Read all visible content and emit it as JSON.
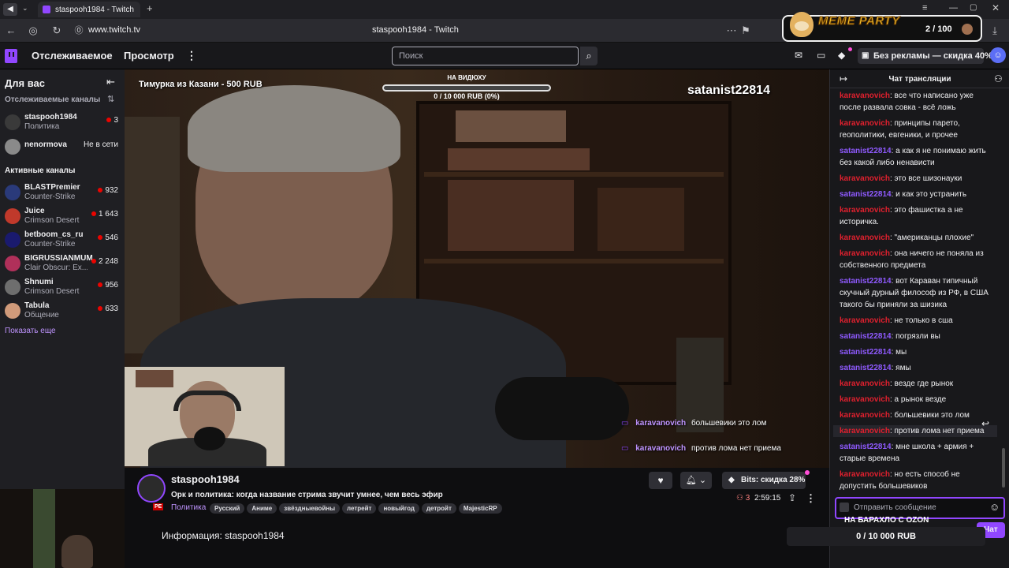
{
  "browser": {
    "tab_title": "staspooh1984 - Twitch",
    "url": "www.twitch.tv",
    "page_title": "staspooh1984 - Twitch"
  },
  "meme_party": {
    "title": "MEME PARTY",
    "counter": "2 / 100"
  },
  "nav": {
    "following": "Отслеживаемое",
    "browse": "Просмотр",
    "search_placeholder": "Поиск",
    "promo": "Без рекламы — скидка 40%"
  },
  "sidebar": {
    "for_you": "Для вас",
    "followed_heading": "Отслеживаемые каналы",
    "followed": [
      {
        "name": "staspooh1984",
        "game": "Политика",
        "viewers": "3",
        "live": true
      },
      {
        "name": "nenormova",
        "game": "",
        "viewers": "Не в сети",
        "live": false
      }
    ],
    "active_heading": "Активные каналы",
    "active": [
      {
        "name": "BLASTPremier",
        "game": "Counter-Strike",
        "viewers": "932"
      },
      {
        "name": "Juice",
        "game": "Crimson Desert",
        "viewers": "1 643"
      },
      {
        "name": "betboom_cs_ru",
        "game": "Counter-Strike",
        "viewers": "546"
      },
      {
        "name": "BIGRUSSIANMUM",
        "game": "Clair Obscur: Ex...",
        "viewers": "2 248"
      },
      {
        "name": "Shnumi",
        "game": "Crimson Desert",
        "viewers": "956"
      },
      {
        "name": "Tabula",
        "game": "Общение",
        "viewers": "633"
      }
    ],
    "show_more": "Показать еще"
  },
  "overlay": {
    "donation": "Тимурка из Казани - 500 RUB",
    "goal_label": "НА ВИДЮХУ",
    "goal_value": "0 / 10 000 RUB (0%)",
    "goal_progress": 0,
    "corner_name": "satanist22814",
    "video_chat": [
      {
        "user": "karavanovich",
        "text": "большевики это лом"
      },
      {
        "user": "karavanovich",
        "text": "против лома нет приема"
      }
    ]
  },
  "stream": {
    "channel": "staspooh1984",
    "title": "Орк и политика: когда название стрима звучит умнее, чем весь эфир",
    "category": "Политика",
    "tags": [
      "Русский",
      "Аниме",
      "звёздныевойны",
      "летрейт",
      "новыйгод",
      "детройт",
      "MajesticRP"
    ],
    "viewers": "3",
    "uptime": "2:59:15",
    "bits_label": "Bits: скидка 28%",
    "about": "Информация: staspooh1984"
  },
  "chat": {
    "header": "Чат трансляции",
    "messages": [
      {
        "user": "karavanovich",
        "color": "red",
        "text": "все что написано уже после развала совка - всё ложь",
        "lines": 2
      },
      {
        "user": "karavanovich",
        "color": "red",
        "text": "принципы парето, геополитики, евгеники, и прочее",
        "lines": 2
      },
      {
        "user": "satanist22814",
        "color": "purple",
        "text": "а как я не понимаю жить без какой либо ненависти",
        "lines": 2
      },
      {
        "user": "karavanovich",
        "color": "red",
        "text": "это все шизонауки",
        "lines": 1
      },
      {
        "user": "satanist22814",
        "color": "purple",
        "text": "и как это устранить",
        "lines": 1
      },
      {
        "user": "karavanovich",
        "color": "red",
        "text": "это фашистка а не историчка.",
        "lines": 2
      },
      {
        "user": "karavanovich",
        "color": "red",
        "text": "\"американцы плохие\"",
        "lines": 1
      },
      {
        "user": "karavanovich",
        "color": "red",
        "text": "она ничего не поняла из собственного предмета",
        "lines": 2
      },
      {
        "user": "satanist22814",
        "color": "purple",
        "text": "вот Караван типичный скучный дурный философ из РФ, в США такого бы приняли за шизика",
        "lines": 3
      },
      {
        "user": "karavanovich",
        "color": "red",
        "text": "не только в сша",
        "lines": 1
      },
      {
        "user": "satanist22814",
        "color": "purple",
        "text": "погрязли вы",
        "lines": 1
      },
      {
        "user": "satanist22814",
        "color": "purple",
        "text": "мы",
        "lines": 1
      },
      {
        "user": "satanist22814",
        "color": "purple",
        "text": "ямы",
        "lines": 1
      },
      {
        "user": "karavanovich",
        "color": "red",
        "text": "везде где рынок",
        "lines": 1
      },
      {
        "user": "karavanovich",
        "color": "red",
        "text": "а рынок везде",
        "lines": 1
      },
      {
        "user": "karavanovich",
        "color": "red",
        "text": "большевики это лом",
        "lines": 1
      },
      {
        "user": "karavanovich",
        "color": "red",
        "text": "против лома нет приема",
        "lines": 1
      },
      {
        "user": "satanist22814",
        "color": "purple",
        "text": "мне школа + армия + старые времена",
        "lines": 2
      },
      {
        "user": "karavanovich",
        "color": "red",
        "text": "но есть способ не допустить большевиков",
        "lines": 2
      }
    ],
    "input_placeholder": "Отправить сообщение",
    "banner": "НА БАРАХЛО С OZON",
    "send_label": "Чат"
  },
  "bottom_goal": "0 / 10 000 RUB"
}
